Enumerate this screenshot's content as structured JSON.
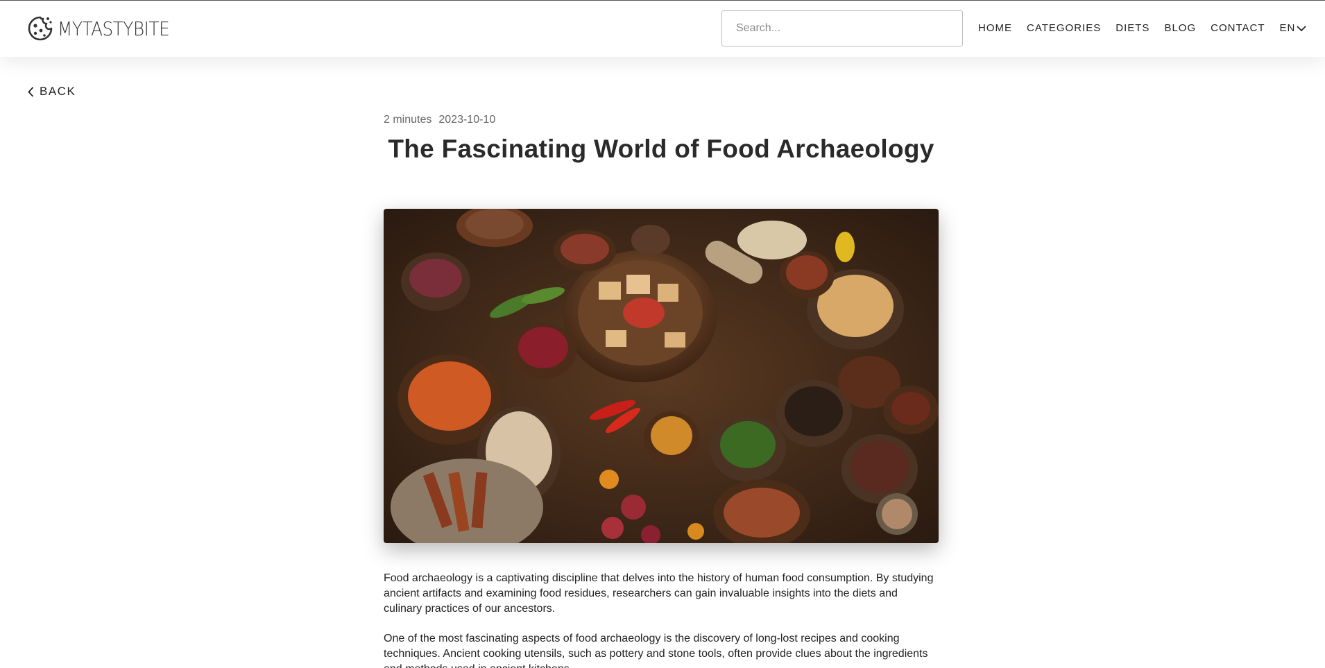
{
  "header": {
    "logo_text": "MYTASTYBITE",
    "search_placeholder": "Search...",
    "nav": {
      "home": "HOME",
      "categories": "CATEGORIES",
      "diets": "DIETS",
      "blog": "BLOG",
      "contact": "CONTACT",
      "language": "EN"
    }
  },
  "back_label": "BACK",
  "article": {
    "read_time": "2 minutes",
    "date": "2023-10-10",
    "title": "The Fascinating World of Food Archaeology",
    "paragraphs": [
      "Food archaeology is a captivating discipline that delves into the history of human food consumption. By studying ancient artifacts and examining food residues, researchers can gain invaluable insights into the diets and culinary practices of our ancestors.",
      "One of the most fascinating aspects of food archaeology is the discovery of long-lost recipes and cooking techniques. Ancient cooking utensils, such as pottery and stone tools, often provide clues about the ingredients and methods used in ancient kitchens."
    ]
  },
  "colors": {
    "text": "#222222",
    "meta": "#666666",
    "search_border": "#bdbdbd"
  }
}
